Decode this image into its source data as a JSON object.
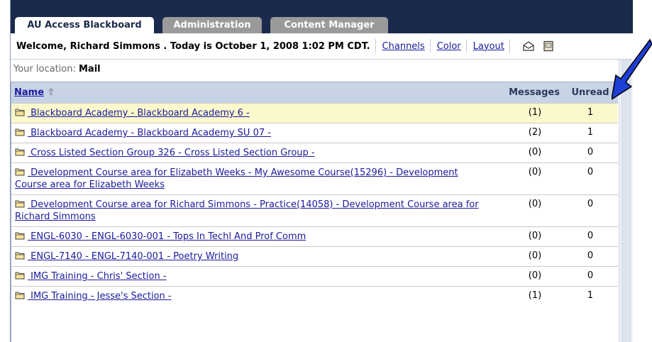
{
  "tabs": [
    {
      "label": "AU Access Blackboard",
      "active": true
    },
    {
      "label": "Administration",
      "active": false
    },
    {
      "label": "Content Manager",
      "active": false
    }
  ],
  "header": {
    "welcome": "Welcome, Richard Simmons . Today is October 1, 2008 1:02 PM CDT.",
    "links": [
      "Channels",
      "Color",
      "Layout"
    ],
    "icons": [
      "mail-icon",
      "calendar-icon"
    ]
  },
  "location": {
    "label": "Your location:",
    "value": "Mail"
  },
  "table": {
    "columns": {
      "name": "Name",
      "sort_indicator": "⇧",
      "messages": "Messages",
      "unread": "Unread"
    },
    "rows": [
      {
        "name": " Blackboard Academy - Blackboard Academy 6 -",
        "messages": "(1)",
        "unread": "1"
      },
      {
        "name": " Blackboard Academy - Blackboard Academy SU 07 -",
        "messages": "(2)",
        "unread": "1"
      },
      {
        "name": " Cross Listed Section Group 326 - Cross Listed Section Group -",
        "messages": "(0)",
        "unread": "0"
      },
      {
        "name": " Development Course area for Elizabeth Weeks - My Awesome Course(15296) - Development Course area for Elizabeth Weeks",
        "messages": "(0)",
        "unread": "0"
      },
      {
        "name": " Development Course area for Richard Simmons - Practice(14058) - Development Course area for Richard Simmons",
        "messages": "(0)",
        "unread": "0"
      },
      {
        "name": " ENGL-6030 - ENGL-6030-001 - Tops In Techl And Prof Comm",
        "messages": "(0)",
        "unread": "0"
      },
      {
        "name": " ENGL-7140 - ENGL-7140-001 - Poetry Writing",
        "messages": "(0)",
        "unread": "0"
      },
      {
        "name": " IMG Training - Chris' Section -",
        "messages": "(0)",
        "unread": "0"
      },
      {
        "name": " IMG Training - Jesse's Section -",
        "messages": "(1)",
        "unread": "1"
      }
    ]
  },
  "colors": {
    "tab_bar": "#1b2a4c",
    "header_row": "#c8d4e6",
    "highlight_row": "#fbf8cc",
    "link": "#1a1a9e",
    "arrow": "#1d3fd6"
  }
}
